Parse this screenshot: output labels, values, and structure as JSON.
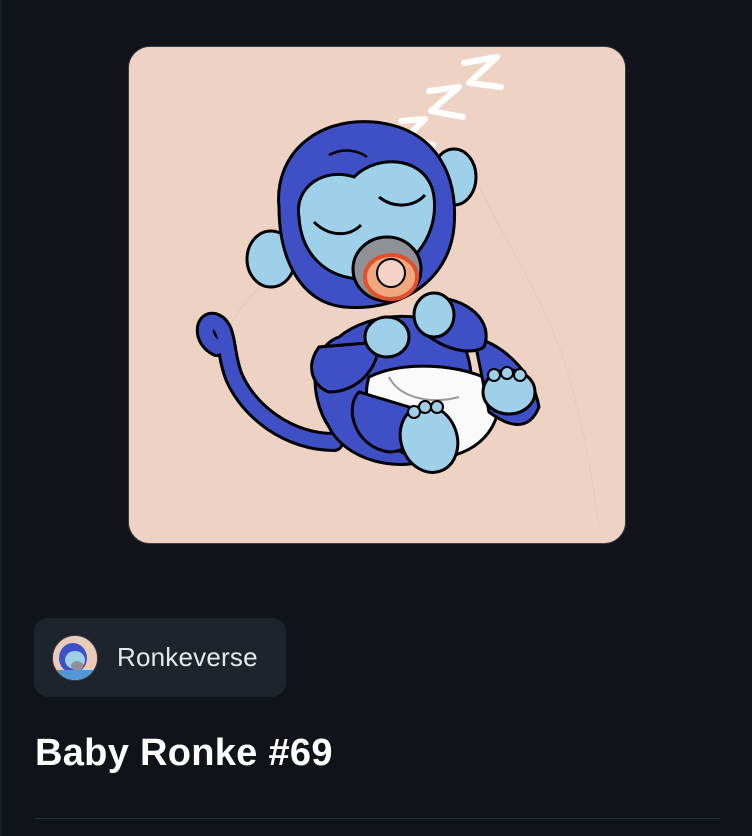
{
  "collection": {
    "name": "Ronkeverse",
    "avatar_icon": "ronke-avatar-icon"
  },
  "item": {
    "title": "Baby Ronke #69",
    "image_icon": "sleeping-baby-monkey-artwork",
    "image_background": "#eed3c4"
  },
  "theme": {
    "background": "#10131a",
    "chip_background": "#1f232b",
    "monkey_blue": "#3f4fc6",
    "monkey_light_blue": "#9fd0ea"
  }
}
